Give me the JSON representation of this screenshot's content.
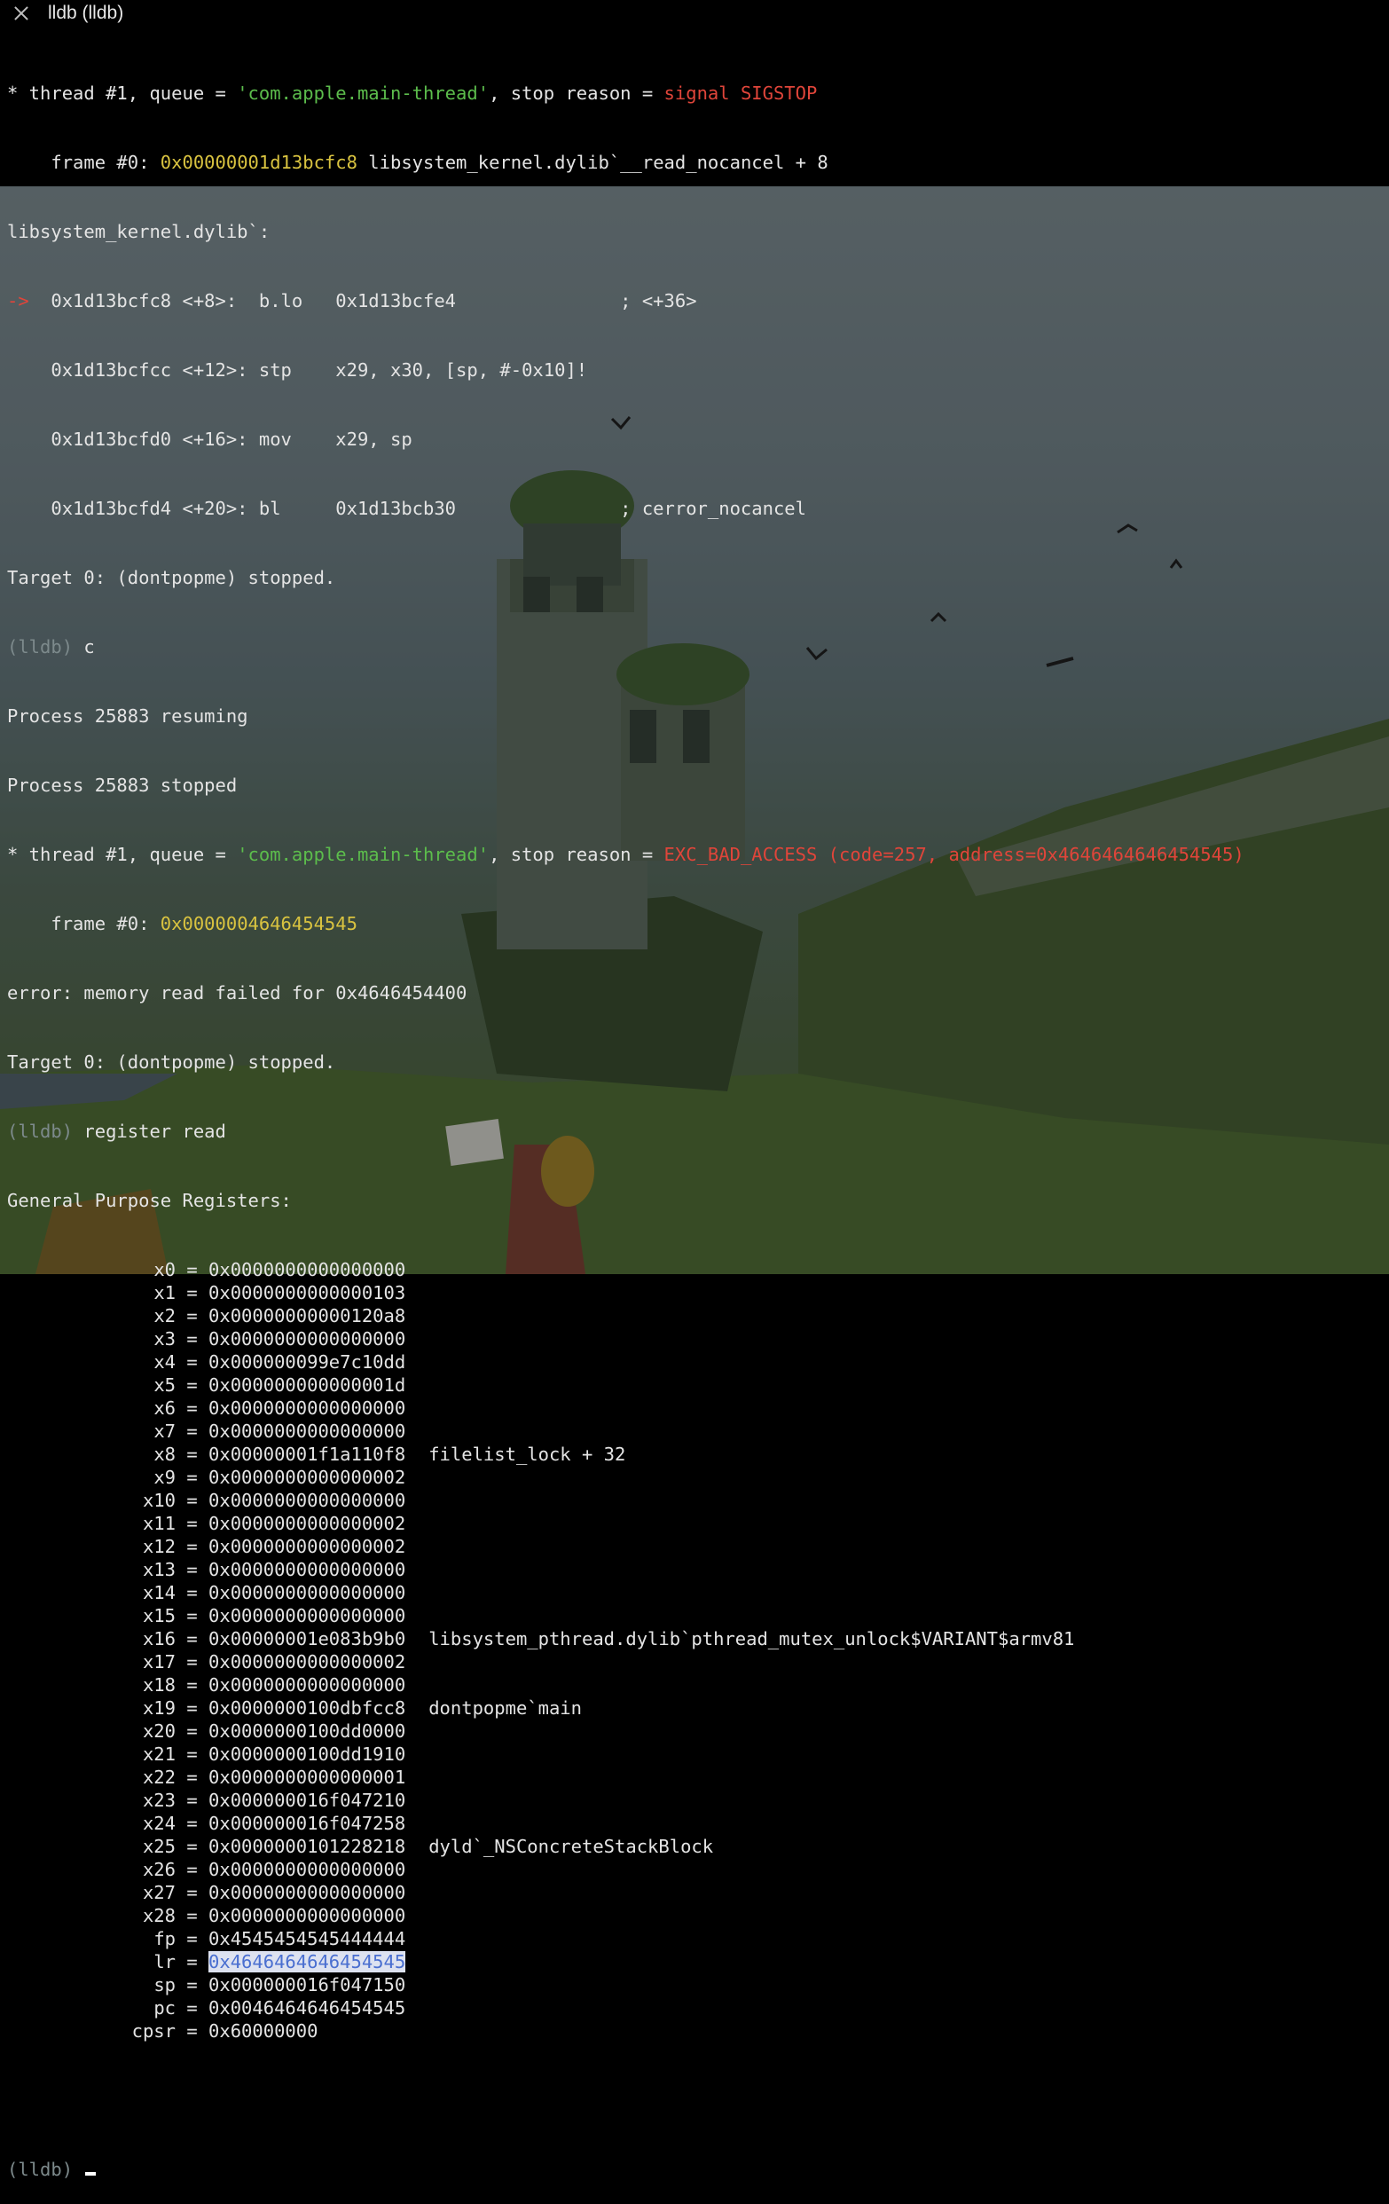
{
  "window": {
    "title": "lldb (lldb)",
    "close_icon": "close-icon"
  },
  "terminal": {
    "stop1": {
      "prefix": "* thread #1, queue = ",
      "queue": "'com.apple.main-thread'",
      "mid": ", stop reason = ",
      "reason": "signal SIGSTOP"
    },
    "frame1": {
      "prefix": "    frame #0: ",
      "addr": "0x00000001d13bcfc8",
      "rest": " libsystem_kernel.dylib`__read_nocancel + 8"
    },
    "module_line": "libsystem_kernel.dylib`:",
    "disasm": [
      "->  0x1d13bcfc8 <+8>:  b.lo   0x1d13bcfe4               ; <+36>",
      "    0x1d13bcfcc <+12>: stp    x29, x30, [sp, #-0x10]!",
      "    0x1d13bcfd0 <+16>: mov    x29, sp",
      "    0x1d13bcfd4 <+20>: bl     0x1d13bcb30               ; cerror_nocancel"
    ],
    "target_stopped_1": "Target 0: (dontpopme) stopped.",
    "prompt": "(lldb)",
    "cmd_continue": " c",
    "resuming": "Process 25883 resuming",
    "stopped": "Process 25883 stopped",
    "stop2": {
      "prefix": "* thread #1, queue = ",
      "queue": "'com.apple.main-thread'",
      "mid": ", stop reason = ",
      "reason": "EXC_BAD_ACCESS (code=257, address=0x4646464646454545)"
    },
    "frame2": {
      "prefix": "    frame #0: ",
      "addr": "0x0000004646454545"
    },
    "error_line": "error: memory read failed for 0x4646454400",
    "target_stopped_2": "Target 0: (dontpopme) stopped.",
    "cmd_register": " register read",
    "gpr_header": "General Purpose Registers:",
    "registers": [
      {
        "name": "x0",
        "value": "0x0000000000000000",
        "sym": ""
      },
      {
        "name": "x1",
        "value": "0x0000000000000103",
        "sym": ""
      },
      {
        "name": "x2",
        "value": "0x00000000000120a8",
        "sym": ""
      },
      {
        "name": "x3",
        "value": "0x0000000000000000",
        "sym": ""
      },
      {
        "name": "x4",
        "value": "0x000000099e7c10dd",
        "sym": ""
      },
      {
        "name": "x5",
        "value": "0x000000000000001d",
        "sym": ""
      },
      {
        "name": "x6",
        "value": "0x0000000000000000",
        "sym": ""
      },
      {
        "name": "x7",
        "value": "0x0000000000000000",
        "sym": ""
      },
      {
        "name": "x8",
        "value": "0x00000001f1a110f8",
        "sym": "filelist_lock + 32"
      },
      {
        "name": "x9",
        "value": "0x0000000000000002",
        "sym": ""
      },
      {
        "name": "x10",
        "value": "0x0000000000000000",
        "sym": ""
      },
      {
        "name": "x11",
        "value": "0x0000000000000002",
        "sym": ""
      },
      {
        "name": "x12",
        "value": "0x0000000000000002",
        "sym": ""
      },
      {
        "name": "x13",
        "value": "0x0000000000000000",
        "sym": ""
      },
      {
        "name": "x14",
        "value": "0x0000000000000000",
        "sym": ""
      },
      {
        "name": "x15",
        "value": "0x0000000000000000",
        "sym": ""
      },
      {
        "name": "x16",
        "value": "0x00000001e083b9b0",
        "sym": "libsystem_pthread.dylib`pthread_mutex_unlock$VARIANT$armv81"
      },
      {
        "name": "x17",
        "value": "0x0000000000000002",
        "sym": ""
      },
      {
        "name": "x18",
        "value": "0x0000000000000000",
        "sym": ""
      },
      {
        "name": "x19",
        "value": "0x0000000100dbfcc8",
        "sym": "dontpopme`main"
      },
      {
        "name": "x20",
        "value": "0x0000000100dd0000",
        "sym": ""
      },
      {
        "name": "x21",
        "value": "0x0000000100dd1910",
        "sym": ""
      },
      {
        "name": "x22",
        "value": "0x0000000000000001",
        "sym": ""
      },
      {
        "name": "x23",
        "value": "0x000000016f047210",
        "sym": ""
      },
      {
        "name": "x24",
        "value": "0x000000016f047258",
        "sym": ""
      },
      {
        "name": "x25",
        "value": "0x0000000101228218",
        "sym": "dyld`_NSConcreteStackBlock"
      },
      {
        "name": "x26",
        "value": "0x0000000000000000",
        "sym": ""
      },
      {
        "name": "x27",
        "value": "0x0000000000000000",
        "sym": ""
      },
      {
        "name": "x28",
        "value": "0x0000000000000000",
        "sym": ""
      },
      {
        "name": "fp",
        "value": "0x4545454545444444",
        "sym": ""
      },
      {
        "name": "lr",
        "value": "0x4646464646454545",
        "sym": "",
        "selected": true
      },
      {
        "name": "sp",
        "value": "0x000000016f047150",
        "sym": ""
      },
      {
        "name": "pc",
        "value": "0x0046464646454545",
        "sym": ""
      },
      {
        "name": "cpsr",
        "value": "0x60000000",
        "sym": ""
      }
    ]
  },
  "colors": {
    "green": "#5cbd4c",
    "red": "#e0453a",
    "yellow": "#d9c340",
    "prompt": "#7d8a8c",
    "selection_bg": "#dde2f0",
    "selection_fg": "#4a6fd0"
  }
}
